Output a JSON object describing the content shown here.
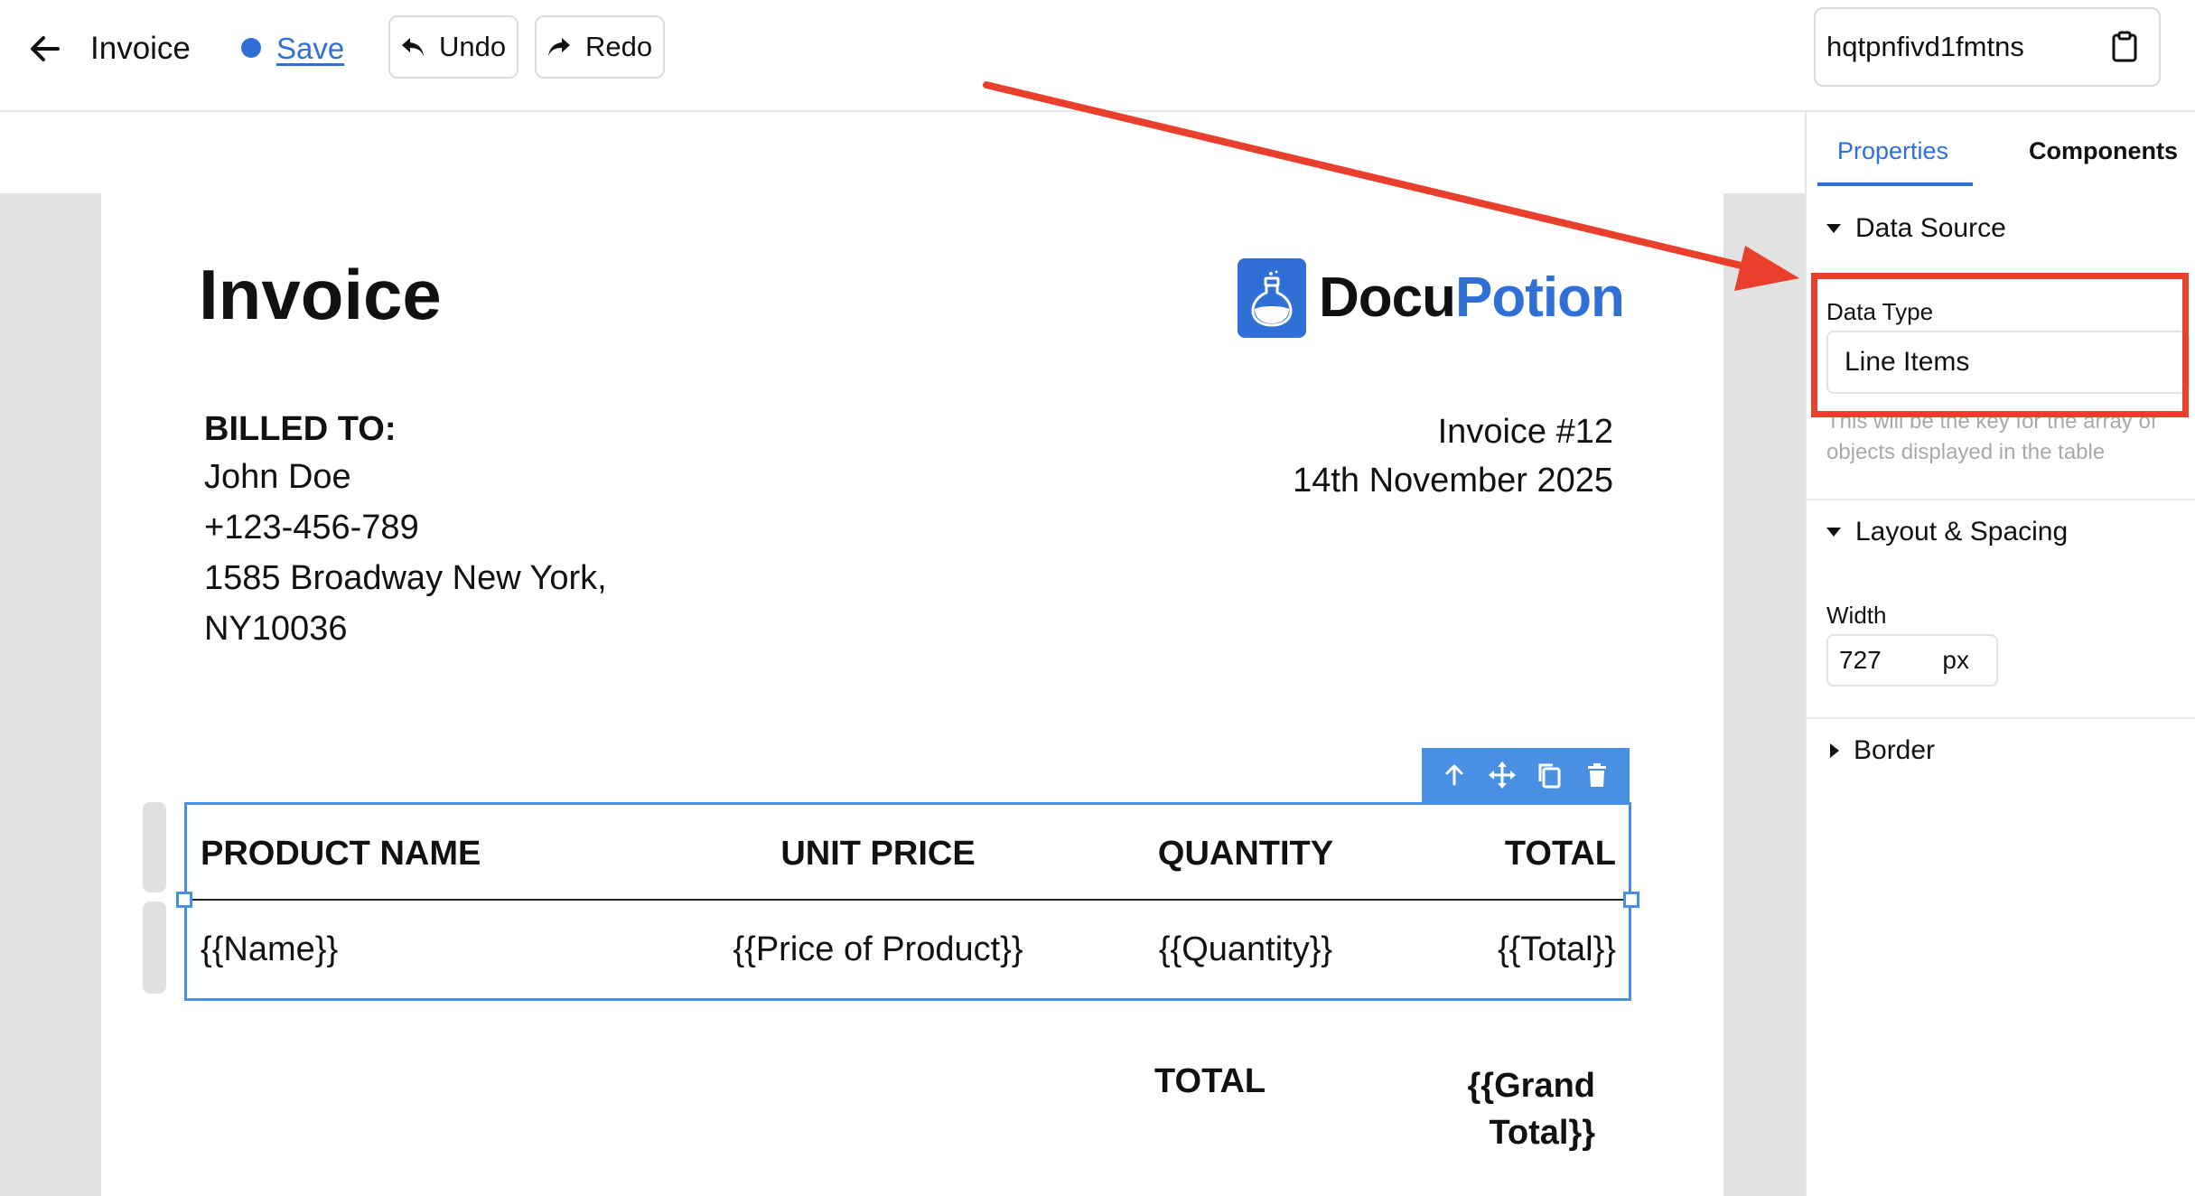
{
  "topbar": {
    "title": "Invoice",
    "save_label": "Save",
    "undo_label": "Undo",
    "redo_label": "Redo",
    "document_id": "hqtpnfivd1fmtns",
    "save_dot_color": "#2f6fd6"
  },
  "document": {
    "heading": "Invoice",
    "logo": {
      "part1": "Docu",
      "part2": "Potion",
      "brand_color": "#2f6fd6",
      "icon": "potion-flask-icon"
    },
    "billed_to": {
      "label": "BILLED TO:",
      "lines": [
        "John Doe",
        "+123-456-789",
        "1585 Broadway New York,",
        "NY10036"
      ]
    },
    "invoice_number": "Invoice #12",
    "invoice_date": "14th November 2025",
    "table": {
      "headers": [
        "PRODUCT NAME",
        "UNIT PRICE",
        "QUANTITY",
        "TOTAL"
      ],
      "row": [
        "{{Name}}",
        "{{Price of Product}}",
        "{{Quantity}}",
        "{{Total}}"
      ]
    },
    "total_label": "TOTAL",
    "grand_total": [
      "{{Grand",
      "Total}}"
    ]
  },
  "selection_toolbar": {
    "icons": [
      "arrow-up-icon",
      "move-icon",
      "duplicate-icon",
      "trash-icon"
    ],
    "color": "#4a90e2"
  },
  "panel": {
    "tabs": [
      "Properties",
      "Components"
    ],
    "active_tab": "Properties",
    "data_source": {
      "title": "Data Source",
      "data_type_label": "Data Type",
      "data_type_value": "Line Items",
      "help": "This will be the key for the array of objects displayed in the table"
    },
    "layout": {
      "title": "Layout & Spacing",
      "width_label": "Width",
      "width_value": "727",
      "width_unit": "px"
    },
    "border": {
      "title": "Border"
    }
  },
  "annotation": {
    "highlight_color": "#e8402c"
  }
}
